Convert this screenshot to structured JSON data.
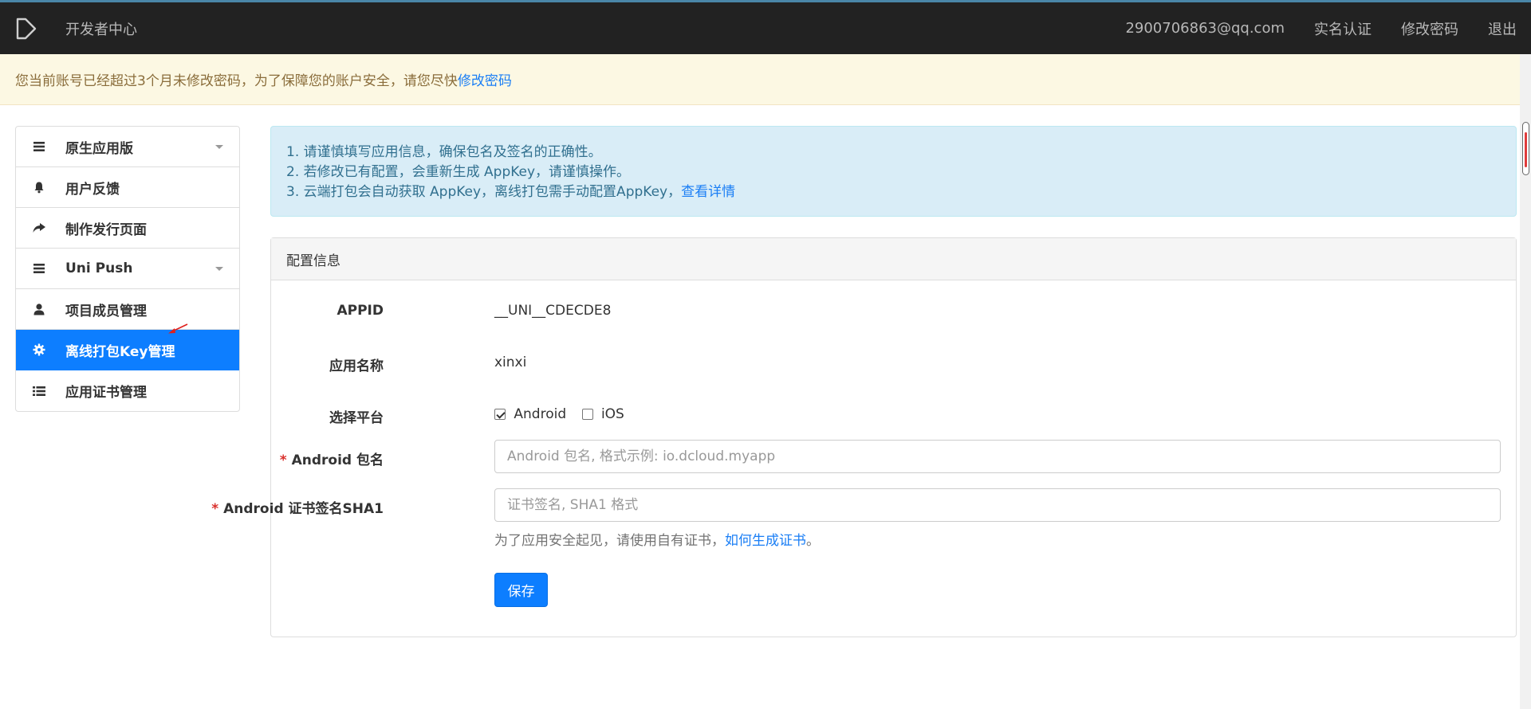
{
  "header": {
    "brand": "开发者中心",
    "email": "2900706863@qq.com",
    "nav": [
      "实名认证",
      "修改密码",
      "退出"
    ]
  },
  "warning": {
    "text": "您当前账号已经超过3个月未修改密码，为了保障您的账户安全，请您尽快",
    "link": "修改密码"
  },
  "sidebar": {
    "items": [
      {
        "label": "原生应用版",
        "icon": "list-icon"
      },
      {
        "label": "用户反馈",
        "icon": "bell-icon"
      },
      {
        "label": "制作发行页面",
        "icon": "share-arrow-icon"
      },
      {
        "label": "Uni Push",
        "icon": "list-icon"
      },
      {
        "label": "项目成员管理",
        "icon": "user-icon"
      },
      {
        "label": "离线打包Key管理",
        "icon": "gear-icon"
      },
      {
        "label": "应用证书管理",
        "icon": "list-icon"
      }
    ]
  },
  "notice": {
    "line1": "1. 请谨慎填写应用信息，确保包名及签名的正确性。",
    "line2": "2. 若修改已有配置，会重新生成 AppKey，请谨慎操作。",
    "line3": "3. 云端打包会自动获取 AppKey，离线打包需手动配置AppKey，",
    "line3_link": "查看详情"
  },
  "panel": {
    "title": "配置信息",
    "appid_label": "APPID",
    "appid_value": "__UNI__CDECDE8",
    "appname_label": "应用名称",
    "appname_value": "xinxi",
    "platform_label": "选择平台",
    "platform_android": "Android",
    "platform_ios": "iOS",
    "required_mark": "*",
    "package_label": "Android 包名",
    "package_placeholder": "Android 包名, 格式示例: io.dcloud.myapp",
    "sha1_label": "Android 证书签名SHA1",
    "sha1_placeholder": "证书签名, SHA1 格式",
    "help_text": "为了应用安全起见，请使用自有证书，",
    "help_link": "如何生成证书",
    "help_end": "。",
    "save_button": "保存"
  },
  "colors": {
    "topbar": "#222222",
    "primary": "#0d7eff",
    "warning_bg": "#fcf8e3",
    "info_bg": "#d9edf7"
  }
}
